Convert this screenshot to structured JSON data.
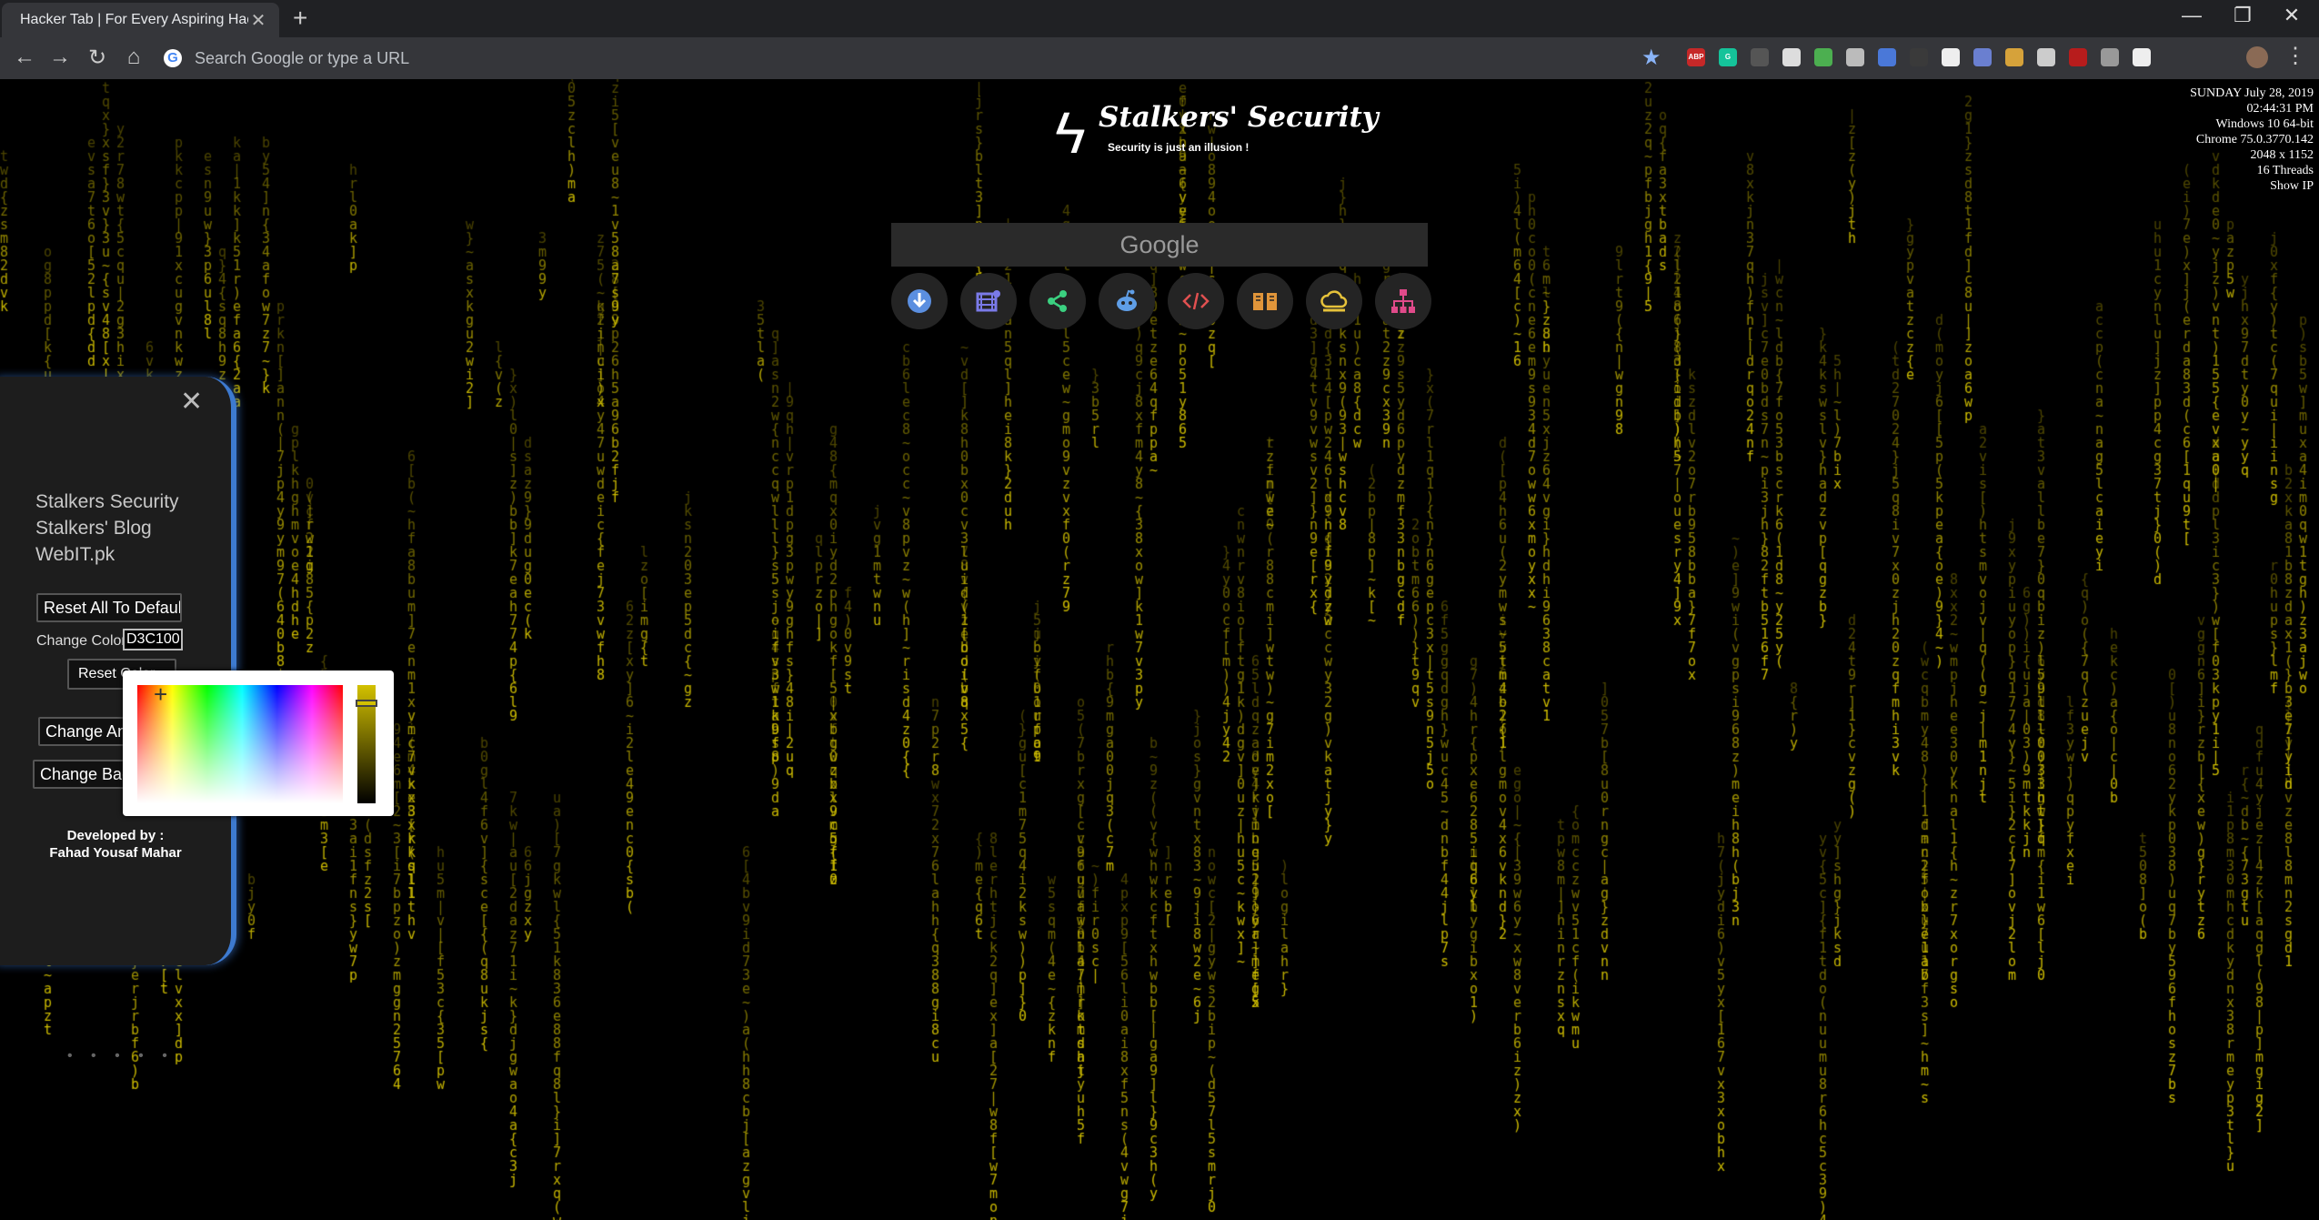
{
  "browser": {
    "tab_title": "Hacker Tab | For Every Aspiring Hacker",
    "tab_close": "✕",
    "new_tab": "+",
    "window_controls": [
      "—",
      "❐",
      "✕"
    ],
    "nav": {
      "back": "←",
      "forward": "→",
      "reload": "↻",
      "home": "⌂"
    },
    "omnibox_placeholder": "Search Google or type a URL",
    "google_glyph": "G",
    "bookmark_star": "★",
    "extensions": [
      {
        "name": "adblock-icon",
        "label": "ABP",
        "color": "#c62828"
      },
      {
        "name": "grammarly-icon",
        "label": "G",
        "color": "#15c39a"
      },
      {
        "name": "screen-icon",
        "label": "",
        "color": "#555555"
      },
      {
        "name": "circle-ext-icon",
        "label": "",
        "color": "#dddddd"
      },
      {
        "name": "color-ext-icon",
        "label": "",
        "color": "#4caf50"
      },
      {
        "name": "privacy-ext-icon",
        "label": "",
        "color": "#bbbbbb"
      },
      {
        "name": "translate-ext-icon",
        "label": "",
        "color": "#4a78d8"
      },
      {
        "name": "drop-ext-icon",
        "label": "",
        "color": "#3a3a3a"
      },
      {
        "name": "speed-ext-icon",
        "label": "",
        "color": "#eeeeee"
      },
      {
        "name": "gear-ext-icon",
        "label": "",
        "color": "#6a7fd0"
      },
      {
        "name": "box-ext-icon",
        "label": "",
        "color": "#d6a23a"
      },
      {
        "name": "trash-ext-icon",
        "label": "",
        "color": "#cccccc"
      },
      {
        "name": "pdf-ext-icon",
        "label": "",
        "color": "#b71c1c"
      },
      {
        "name": "camera-ext-icon",
        "label": "",
        "color": "#999999"
      },
      {
        "name": "server-ext-icon",
        "label": "",
        "color": "#eeeeee"
      }
    ],
    "menu": "⋮"
  },
  "logo": {
    "bolt": "ϟ",
    "name": "Stalkers' Security",
    "tagline": "Security is just an illusion !"
  },
  "search": {
    "placeholder": "Google"
  },
  "shortcuts": [
    {
      "name": "download-icon",
      "color": "#5b8fe0"
    },
    {
      "name": "video-icon",
      "color": "#7a7ae8"
    },
    {
      "name": "share-icon",
      "color": "#3bd080"
    },
    {
      "name": "reddit-icon",
      "color": "#5f9ee6"
    },
    {
      "name": "code-icon",
      "color": "#e05050"
    },
    {
      "name": "book-icon",
      "color": "#e0953a"
    },
    {
      "name": "cloud-icon",
      "color": "#e6c23a"
    },
    {
      "name": "sitemap-icon",
      "color": "#e04a8a"
    }
  ],
  "sysinfo": [
    "SUNDAY July 28, 2019",
    "02:44:31 PM",
    "Windows 10 64-bit",
    "Chrome 75.0.3770.142",
    "2048 x 1152",
    "16 Threads",
    "Show IP"
  ],
  "panel": {
    "close": "✕",
    "links": [
      "Stalkers Security",
      "Stalkers' Blog",
      "WebIT.pk"
    ],
    "reset_all": "Reset All To Default",
    "change_color_label": "Change Color",
    "change_color_value": "D3C100",
    "reset_color": "Reset Color",
    "change_animation": "Change Animation",
    "change_background": "Change Background",
    "dots": "• • • • •",
    "developed_by": "Developed by :",
    "developer": "Fahad Yousaf Mahar"
  },
  "color_picker": {
    "crosshair": "+",
    "selected_color": "#D3C100"
  },
  "matrix": {
    "glyph_color": "#d3c100",
    "charset": "abcdefghijklmnopqrstuvwxyz0123456789(){}[]~|"
  }
}
